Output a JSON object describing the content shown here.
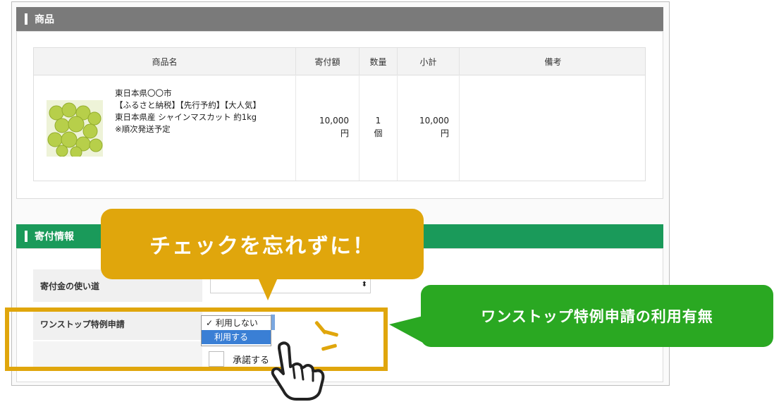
{
  "sections": {
    "product_title": "商品",
    "kifu_title": "寄付情報"
  },
  "table": {
    "headers": [
      "商品名",
      "寄付額",
      "数量",
      "小計",
      "備考"
    ],
    "row": {
      "description": [
        "東日本県〇〇市",
        "【ふるさと納税】【先行予約】【大人気】",
        "東日本県産 シャインマスカット 約1kg",
        "※順次発送予定"
      ],
      "amount": "10,000",
      "amount_unit": "円",
      "qty": "1",
      "qty_unit": "個",
      "subtotal": "10,000",
      "subtotal_unit": "円",
      "note": ""
    }
  },
  "form": {
    "usage_label": "寄付金の使い道",
    "onestop_label": "ワンストップ特例申請",
    "select_arrow": "⬍",
    "dropdown_options": [
      "✓ 利用しない",
      "利用する"
    ],
    "agree_label": "承諾する"
  },
  "callouts": {
    "yellow_text": "チェックを忘れずに！",
    "green_text": "ワンストップ特例申請の利用有無"
  },
  "colors": {
    "accent_yellow": "#e0a60c",
    "accent_green": "#2aa822",
    "section_gray": "#7a7a7a",
    "section_green": "#1a9a5a",
    "select_blue": "#3a7fd5"
  },
  "icons": [
    "pointing-hand-icon",
    "grapes-image"
  ]
}
